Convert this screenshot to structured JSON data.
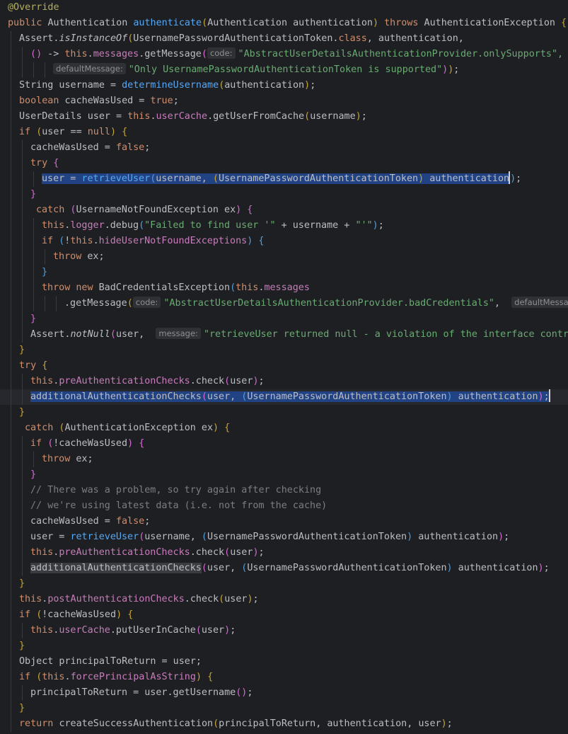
{
  "editor": {
    "lines": [
      {
        "indent": 0,
        "tokens": [
          {
            "t": "@Override",
            "c": "ann"
          }
        ]
      },
      {
        "indent": 0,
        "tokens": [
          {
            "t": "public ",
            "c": "kw"
          },
          {
            "t": "Authentication "
          },
          {
            "t": "authenticate",
            "c": "fn"
          },
          {
            "t": "(",
            "c": "d1"
          },
          {
            "t": "Authentication authentication"
          },
          {
            "t": ")",
            "c": "d1"
          },
          {
            "t": " throws ",
            "c": "kw"
          },
          {
            "t": "AuthenticationException "
          },
          {
            "t": "{",
            "c": "d1"
          }
        ]
      },
      {
        "indent": 1,
        "tokens": [
          {
            "t": "Assert."
          },
          {
            "t": "isInstanceOf",
            "c": "it"
          },
          {
            "t": "(",
            "c": "d1"
          },
          {
            "t": "UsernamePasswordAuthenticationToken."
          },
          {
            "t": "class",
            "c": "kw"
          },
          {
            "t": ", authentication,"
          }
        ]
      },
      {
        "indent": 2,
        "tokens": [
          {
            "t": "(",
            "c": "d2"
          },
          {
            "t": ")",
            "c": "d2"
          },
          {
            "t": " -> "
          },
          {
            "t": "this",
            "c": "kw"
          },
          {
            "t": "."
          },
          {
            "t": "messages",
            "c": "fld"
          },
          {
            "t": ".getMessage"
          },
          {
            "t": "(",
            "c": "d2"
          },
          {
            "t": "code:",
            "hint": true
          },
          {
            "t": "\"AbstractUserDetailsAuthenticationProvider.onlySupports\",",
            "c": "str"
          }
        ]
      },
      {
        "indent": 4,
        "tokens": [
          {
            "t": "defaultMessage:",
            "hint": true
          },
          {
            "t": "\"Only UsernamePasswordAuthenticationToken is supported\"",
            "c": "str"
          },
          {
            "t": ")",
            "c": "d2"
          },
          {
            "t": ")",
            "c": "d1"
          },
          {
            "t": ";"
          }
        ]
      },
      {
        "indent": 1,
        "tokens": [
          {
            "t": "String username = "
          },
          {
            "t": "determineUsername",
            "c": "fn"
          },
          {
            "t": "(",
            "c": "d1"
          },
          {
            "t": "authentication"
          },
          {
            "t": ")",
            "c": "d1"
          },
          {
            "t": ";"
          }
        ]
      },
      {
        "indent": 1,
        "tokens": [
          {
            "t": "boolean ",
            "c": "kw"
          },
          {
            "t": "cacheWasUsed = "
          },
          {
            "t": "true",
            "c": "kw"
          },
          {
            "t": ";"
          }
        ]
      },
      {
        "indent": 1,
        "tokens": [
          {
            "t": "UserDetails user = "
          },
          {
            "t": "this",
            "c": "kw"
          },
          {
            "t": "."
          },
          {
            "t": "userCache",
            "c": "fld"
          },
          {
            "t": ".getUserFromCache"
          },
          {
            "t": "(",
            "c": "d1"
          },
          {
            "t": "username"
          },
          {
            "t": ")",
            "c": "d1"
          },
          {
            "t": ";"
          }
        ]
      },
      {
        "indent": 1,
        "tokens": [
          {
            "t": "if ",
            "c": "kw"
          },
          {
            "t": "(",
            "c": "d1"
          },
          {
            "t": "user == "
          },
          {
            "t": "null",
            "c": "kw"
          },
          {
            "t": ")",
            "c": "d1"
          },
          {
            "t": " "
          },
          {
            "t": "{",
            "c": "d1"
          }
        ]
      },
      {
        "indent": 2,
        "tokens": [
          {
            "t": "cacheWasUsed = "
          },
          {
            "t": "false",
            "c": "kw"
          },
          {
            "t": ";"
          }
        ]
      },
      {
        "indent": 2,
        "tokens": [
          {
            "t": "try ",
            "c": "kw"
          },
          {
            "t": "{",
            "c": "d2"
          }
        ]
      },
      {
        "indent": 3,
        "tokens": [
          {
            "t": "user = ",
            "sel": true
          },
          {
            "t": "retrieveUser",
            "c": "fn",
            "sel": true
          },
          {
            "t": "(",
            "c": "d3",
            "sel": true
          },
          {
            "t": "username, ",
            "sel": true
          },
          {
            "t": "(",
            "c": "d1",
            "sel": true
          },
          {
            "t": "UsernamePasswordAuthenticationToken",
            "sel": true
          },
          {
            "t": ")",
            "c": "d1",
            "sel": true
          },
          {
            "t": " authentication",
            "sel": true
          },
          {
            "t": "caret",
            "caret": true
          },
          {
            "t": ")",
            "c": "d3"
          },
          {
            "t": ";"
          }
        ]
      },
      {
        "indent": 2,
        "tokens": [
          {
            "t": "}",
            "c": "d2"
          }
        ]
      },
      {
        "indent": 2,
        "pad": 8,
        "tokens": [
          {
            "t": "catch ",
            "c": "kw"
          },
          {
            "t": "(",
            "c": "d2"
          },
          {
            "t": "UsernameNotFoundException ex"
          },
          {
            "t": ")",
            "c": "d2"
          },
          {
            "t": " "
          },
          {
            "t": "{",
            "c": "d2"
          }
        ]
      },
      {
        "indent": 3,
        "tokens": [
          {
            "t": "this",
            "c": "kw"
          },
          {
            "t": "."
          },
          {
            "t": "logger",
            "c": "fld"
          },
          {
            "t": ".debug"
          },
          {
            "t": "(",
            "c": "d3"
          },
          {
            "t": "\"Failed to find user '\"",
            "c": "str"
          },
          {
            "t": " + username + "
          },
          {
            "t": "\"'\"",
            "c": "str"
          },
          {
            "t": ")",
            "c": "d3"
          },
          {
            "t": ";"
          }
        ]
      },
      {
        "indent": 3,
        "tokens": [
          {
            "t": "if ",
            "c": "kw"
          },
          {
            "t": "(",
            "c": "d3"
          },
          {
            "t": "!"
          },
          {
            "t": "this",
            "c": "kw"
          },
          {
            "t": "."
          },
          {
            "t": "hideUserNotFoundExceptions",
            "c": "fld"
          },
          {
            "t": ")",
            "c": "d3"
          },
          {
            "t": " "
          },
          {
            "t": "{",
            "c": "d3"
          }
        ]
      },
      {
        "indent": 4,
        "tokens": [
          {
            "t": "throw ",
            "c": "kw"
          },
          {
            "t": "ex;"
          }
        ]
      },
      {
        "indent": 3,
        "tokens": [
          {
            "t": "}",
            "c": "d3"
          }
        ]
      },
      {
        "indent": 3,
        "tokens": [
          {
            "t": "throw new ",
            "c": "kw"
          },
          {
            "t": "BadCredentialsException"
          },
          {
            "t": "(",
            "c": "d3"
          },
          {
            "t": "this",
            "c": "kw"
          },
          {
            "t": "."
          },
          {
            "t": "messages",
            "c": "fld"
          }
        ]
      },
      {
        "indent": 5,
        "tokens": [
          {
            "t": ".getMessage"
          },
          {
            "t": "(",
            "c": "d1"
          },
          {
            "t": "code:",
            "hint": true
          },
          {
            "t": "\"AbstractUserDetailsAuthenticationProvider.badCredentials\"",
            "c": "str"
          },
          {
            "t": ",  "
          },
          {
            "t": "defaultMessage",
            "hint": true
          }
        ]
      },
      {
        "indent": 2,
        "tokens": [
          {
            "t": "}",
            "c": "d2"
          }
        ]
      },
      {
        "indent": 2,
        "tokens": [
          {
            "t": "Assert."
          },
          {
            "t": "notNull",
            "c": "it"
          },
          {
            "t": "(",
            "c": "d2"
          },
          {
            "t": "user,  "
          },
          {
            "t": "message:",
            "hint": true
          },
          {
            "t": "\"retrieveUser returned null - a violation of the interface contract\"",
            "c": "str"
          }
        ]
      },
      {
        "indent": 1,
        "tokens": [
          {
            "t": "}",
            "c": "d1"
          }
        ]
      },
      {
        "indent": 1,
        "tokens": [
          {
            "t": "try ",
            "c": "kw"
          },
          {
            "t": "{",
            "c": "d1"
          }
        ]
      },
      {
        "indent": 2,
        "tokens": [
          {
            "t": "this",
            "c": "kw"
          },
          {
            "t": "."
          },
          {
            "t": "preAuthenticationChecks",
            "c": "fld"
          },
          {
            "t": ".check"
          },
          {
            "t": "(",
            "c": "d2"
          },
          {
            "t": "user"
          },
          {
            "t": ")",
            "c": "d2"
          },
          {
            "t": ";"
          }
        ]
      },
      {
        "indent": 2,
        "caretLine": true,
        "tokens": [
          {
            "t": "additionalAuthenticationChecks",
            "sel": true
          },
          {
            "t": "(",
            "c": "d2",
            "sel": true
          },
          {
            "t": "user, ",
            "sel": true
          },
          {
            "t": "(",
            "c": "d3",
            "sel": true
          },
          {
            "t": "UsernamePasswordAuthenticationToken",
            "sel": true
          },
          {
            "t": ")",
            "c": "d3",
            "sel": true
          },
          {
            "t": " authentication",
            "sel": true
          },
          {
            "t": ")",
            "c": "d2",
            "sel": true
          },
          {
            "t": ";",
            "sel": true
          },
          {
            "t": "caret",
            "caret": true
          }
        ]
      },
      {
        "indent": 1,
        "tokens": [
          {
            "t": "}",
            "c": "d1"
          }
        ]
      },
      {
        "indent": 1,
        "pad": 8,
        "tokens": [
          {
            "t": "catch ",
            "c": "kw"
          },
          {
            "t": "(",
            "c": "d1"
          },
          {
            "t": "AuthenticationException ex"
          },
          {
            "t": ")",
            "c": "d1"
          },
          {
            "t": " "
          },
          {
            "t": "{",
            "c": "d1"
          }
        ]
      },
      {
        "indent": 2,
        "tokens": [
          {
            "t": "if ",
            "c": "kw"
          },
          {
            "t": "(",
            "c": "d2"
          },
          {
            "t": "!cacheWasUsed"
          },
          {
            "t": ")",
            "c": "d2"
          },
          {
            "t": " "
          },
          {
            "t": "{",
            "c": "d2"
          }
        ]
      },
      {
        "indent": 3,
        "tokens": [
          {
            "t": "throw ",
            "c": "kw"
          },
          {
            "t": "ex;"
          }
        ]
      },
      {
        "indent": 2,
        "tokens": [
          {
            "t": "}",
            "c": "d2"
          }
        ]
      },
      {
        "indent": 2,
        "tokens": [
          {
            "t": "// There was a problem, so try again after checking",
            "c": "cmt"
          }
        ]
      },
      {
        "indent": 2,
        "tokens": [
          {
            "t": "// we're using latest data (i.e. not from the cache)",
            "c": "cmt"
          }
        ]
      },
      {
        "indent": 2,
        "tokens": [
          {
            "t": "cacheWasUsed = "
          },
          {
            "t": "false",
            "c": "kw"
          },
          {
            "t": ";"
          }
        ]
      },
      {
        "indent": 2,
        "tokens": [
          {
            "t": "user = "
          },
          {
            "t": "retrieveUser",
            "c": "fn"
          },
          {
            "t": "(",
            "c": "d2"
          },
          {
            "t": "username, "
          },
          {
            "t": "(",
            "c": "d3"
          },
          {
            "t": "UsernamePasswordAuthenticationToken"
          },
          {
            "t": ")",
            "c": "d3"
          },
          {
            "t": " authentication"
          },
          {
            "t": ")",
            "c": "d2"
          },
          {
            "t": ";"
          }
        ]
      },
      {
        "indent": 2,
        "tokens": [
          {
            "t": "this",
            "c": "kw"
          },
          {
            "t": "."
          },
          {
            "t": "preAuthenticationChecks",
            "c": "fld"
          },
          {
            "t": ".check"
          },
          {
            "t": "(",
            "c": "d2"
          },
          {
            "t": "user"
          },
          {
            "t": ")",
            "c": "d2"
          },
          {
            "t": ";"
          }
        ]
      },
      {
        "indent": 2,
        "tokens": [
          {
            "t": "additionalAuthenticationChecks",
            "under": true
          },
          {
            "t": "(",
            "c": "d2"
          },
          {
            "t": "user, "
          },
          {
            "t": "(",
            "c": "d3"
          },
          {
            "t": "UsernamePasswordAuthenticationToken"
          },
          {
            "t": ")",
            "c": "d3"
          },
          {
            "t": " authentication"
          },
          {
            "t": ")",
            "c": "d2"
          },
          {
            "t": ";"
          }
        ]
      },
      {
        "indent": 1,
        "tokens": [
          {
            "t": "}",
            "c": "d1"
          }
        ]
      },
      {
        "indent": 1,
        "tokens": [
          {
            "t": "this",
            "c": "kw"
          },
          {
            "t": "."
          },
          {
            "t": "postAuthenticationChecks",
            "c": "fld"
          },
          {
            "t": ".check"
          },
          {
            "t": "(",
            "c": "d1"
          },
          {
            "t": "user"
          },
          {
            "t": ")",
            "c": "d1"
          },
          {
            "t": ";"
          }
        ]
      },
      {
        "indent": 1,
        "tokens": [
          {
            "t": "if ",
            "c": "kw"
          },
          {
            "t": "(",
            "c": "d1"
          },
          {
            "t": "!cacheWasUsed"
          },
          {
            "t": ")",
            "c": "d1"
          },
          {
            "t": " "
          },
          {
            "t": "{",
            "c": "d1"
          }
        ]
      },
      {
        "indent": 2,
        "tokens": [
          {
            "t": "this",
            "c": "kw"
          },
          {
            "t": "."
          },
          {
            "t": "userCache",
            "c": "fld"
          },
          {
            "t": ".putUserInCache"
          },
          {
            "t": "(",
            "c": "d2"
          },
          {
            "t": "user"
          },
          {
            "t": ")",
            "c": "d2"
          },
          {
            "t": ";"
          }
        ]
      },
      {
        "indent": 1,
        "tokens": [
          {
            "t": "}",
            "c": "d1"
          }
        ]
      },
      {
        "indent": 1,
        "tokens": [
          {
            "t": "Object principalToReturn = user;"
          }
        ]
      },
      {
        "indent": 1,
        "tokens": [
          {
            "t": "if ",
            "c": "kw"
          },
          {
            "t": "(",
            "c": "d1"
          },
          {
            "t": "this",
            "c": "kw"
          },
          {
            "t": "."
          },
          {
            "t": "forcePrincipalAsString",
            "c": "fld"
          },
          {
            "t": ")",
            "c": "d1"
          },
          {
            "t": " "
          },
          {
            "t": "{",
            "c": "d1"
          }
        ]
      },
      {
        "indent": 2,
        "tokens": [
          {
            "t": "principalToReturn = user.getUsername"
          },
          {
            "t": "(",
            "c": "d2"
          },
          {
            "t": ")",
            "c": "d2"
          },
          {
            "t": ";"
          }
        ]
      },
      {
        "indent": 1,
        "tokens": [
          {
            "t": "}",
            "c": "d1"
          }
        ]
      },
      {
        "indent": 1,
        "tokens": [
          {
            "t": "return ",
            "c": "kw"
          },
          {
            "t": "createSuccessAuthentication"
          },
          {
            "t": "(",
            "c": "d1"
          },
          {
            "t": "principalToReturn, authentication, user"
          },
          {
            "t": ")",
            "c": "d1"
          },
          {
            "t": ";"
          }
        ]
      }
    ]
  }
}
